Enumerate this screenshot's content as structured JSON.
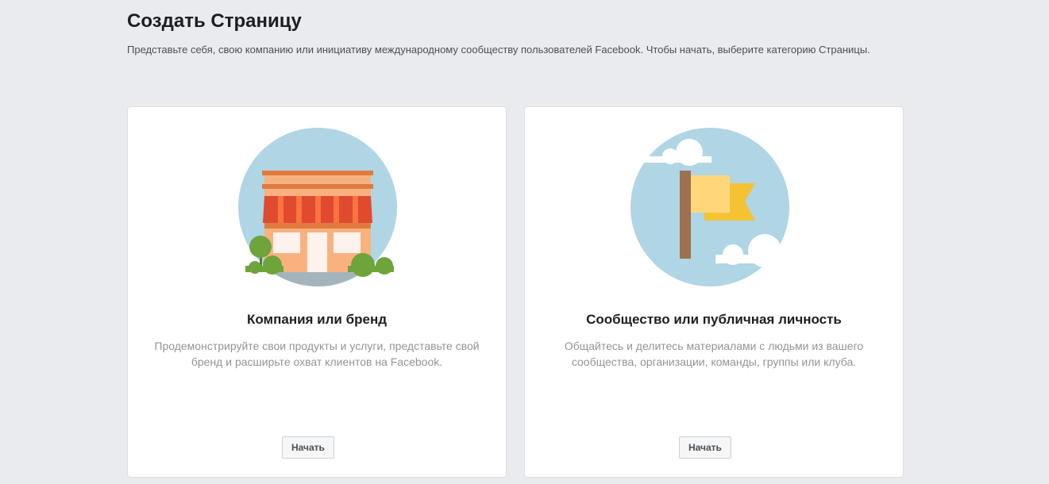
{
  "header": {
    "title": "Создать Страницу",
    "description": "Представьте себя, свою компанию или инициативу международному сообществу пользователей Facebook. Чтобы начать, выберите категорию Страницы."
  },
  "cards": [
    {
      "title": "Компания или бренд",
      "description": "Продемонстрируйте свои продукты и услуги, представьте свой бренд и расширьте охват клиентов на Facebook.",
      "button_label": "Начать",
      "icon": "storefront-icon"
    },
    {
      "title": "Сообщество или публичная личность",
      "description": "Общайтесь и делитесь материалами с людьми из вашего сообщества, организации, команды, группы или клуба.",
      "button_label": "Начать",
      "icon": "flag-icon"
    }
  ],
  "colors": {
    "background": "#e9ebee",
    "illustration_sky": "#b0d5e4",
    "awning_red": "#e04a2f",
    "store_wall": "#f9b27f",
    "shrub_green": "#6fa33c",
    "flag_yellow": "#ffd77a",
    "flag_gold": "#f5c233",
    "flag_pole": "#9e7151"
  }
}
